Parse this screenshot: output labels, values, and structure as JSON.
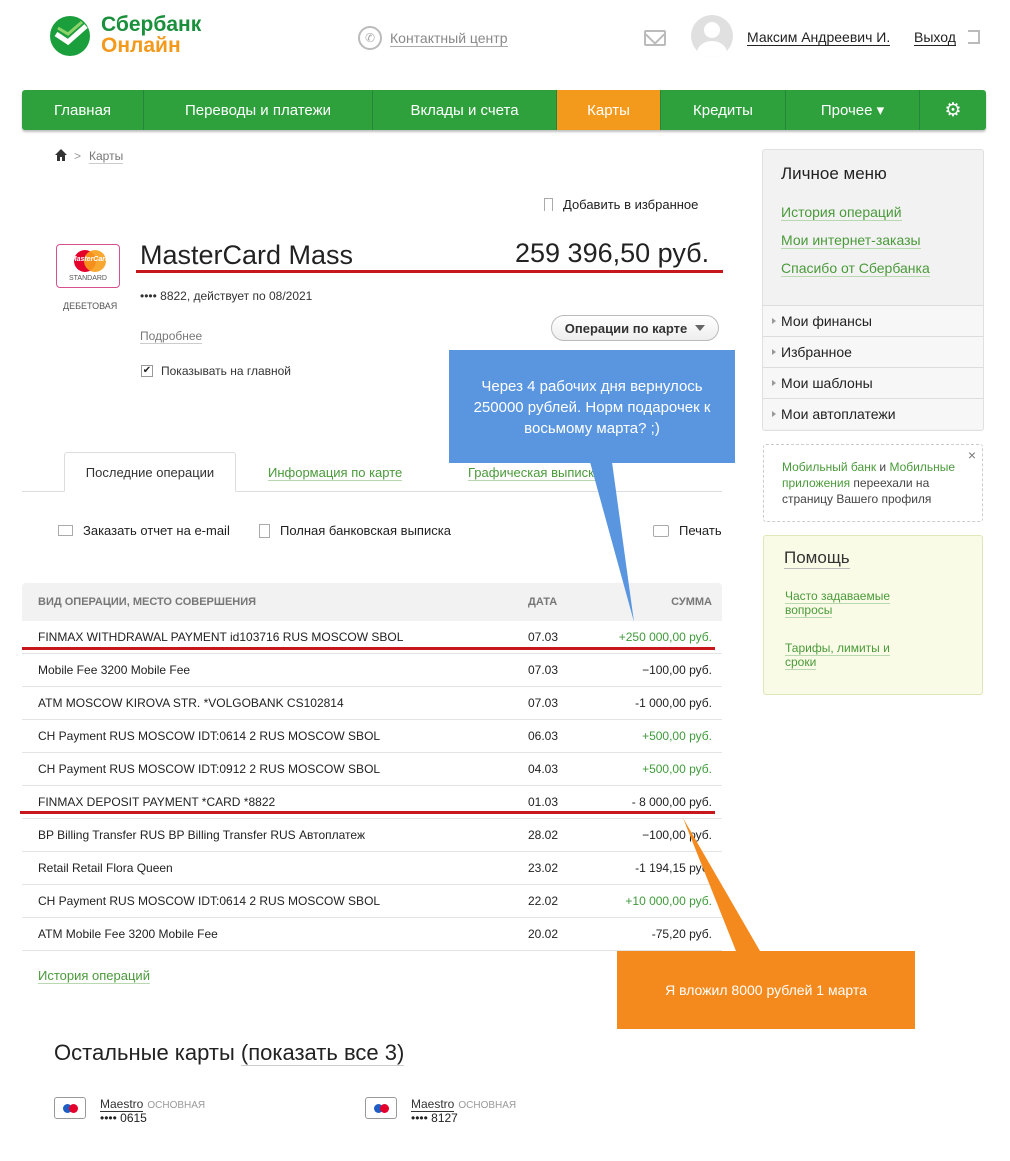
{
  "header": {
    "logo_line1": "Сбербанк",
    "logo_line2": "Онлайн",
    "contact_center": "Контактный центр",
    "user_name": "Максим Андреевич И.",
    "logout": "Выход"
  },
  "nav": {
    "items": [
      {
        "label": "Главная"
      },
      {
        "label": "Переводы и платежи"
      },
      {
        "label": "Вклады и счета"
      },
      {
        "label": "Карты"
      },
      {
        "label": "Кредиты"
      },
      {
        "label": "Прочее ▾"
      }
    ],
    "active": "Карты",
    "colors": {
      "nav": "#2ea13d",
      "active": "#f39a1d"
    }
  },
  "breadcrumb": {
    "cards": "Карты"
  },
  "favorite": "Добавить в избранное",
  "card": {
    "name": "MasterCard Mass",
    "balance": "259 396,50 руб.",
    "logo_text": "MasterCard",
    "logo_sub": "STANDARD",
    "kind": "ДЕБЕТОВАЯ",
    "number_info": "•••• 8822, действует по 08/2021",
    "details": "Подробнее",
    "operations_button": "Операции по карте",
    "show_on_main": "Показывать на главной",
    "show_on_main_checked": "✔"
  },
  "tabs": {
    "recent": "Последние операции",
    "info": "Информация по карте",
    "graph": "Графическая выписка"
  },
  "actions": {
    "email_report": "Заказать отчет на e-mail",
    "full_statement": "Полная банковская выписка",
    "print": "Печать"
  },
  "table": {
    "headers": {
      "desc": "ВИД ОПЕРАЦИИ, МЕСТО СОВЕРШЕНИЯ",
      "date": "ДАТА",
      "sum": "СУММА"
    },
    "rows": [
      {
        "desc": "FINMAX WITHDRAWAL PAYMENT id103716 RUS MOSCOW SBOL",
        "date": "07.03",
        "sum": "+250 000,00 руб."
      },
      {
        "desc": "Mobile Fee 3200 Mobile Fee",
        "date": "07.03",
        "sum": "−100,00 руб."
      },
      {
        "desc": "ATM MOSCOW KIROVA STR. *VOLGOBANK CS102814",
        "date": "07.03",
        "sum": "-1 000,00 руб."
      },
      {
        "desc": "CH Payment RUS MOSCOW IDT:0614 2 RUS MOSCOW SBOL",
        "date": "06.03",
        "sum": "+500,00 руб."
      },
      {
        "desc": "CH Payment RUS MOSCOW IDT:0912 2 RUS MOSCOW SBOL",
        "date": "04.03",
        "sum": "+500,00 руб."
      },
      {
        "desc": "FINMAX DEPOSIT PAYMENT *CARD *8822",
        "date": "01.03",
        "sum": "- 8 000,00 руб."
      },
      {
        "desc": "BP Billing Transfer RUS BP Billing Transfer RUS Автоплатеж",
        "date": "28.02",
        "sum": "−100,00 руб."
      },
      {
        "desc": "Retail Retail Flora Queen",
        "date": "23.02",
        "sum": "-1 194,15 руб."
      },
      {
        "desc": "CH Payment RUS MOSCOW IDT:0614 2 RUS MOSCOW SBOL",
        "date": "22.02",
        "sum": "+10 000,00 руб."
      },
      {
        "desc": "ATM Mobile Fee 3200 Mobile Fee",
        "date": "20.02",
        "sum": "-75,20 руб."
      }
    ],
    "history_link": "История операций"
  },
  "other_cards": {
    "title_prefix": "Остальные карты ",
    "title_link": "(показать все 3)",
    "cards": [
      {
        "name": "Maestro",
        "tag": "ОСНОВНАЯ",
        "number": "•••• 0615"
      },
      {
        "name": "Maestro",
        "tag": "ОСНОВНАЯ",
        "number": "•••• 8127"
      }
    ]
  },
  "personal_menu": {
    "title": "Личное меню",
    "links": [
      "История операций",
      "Мои интернет-заказы",
      "Спасибо от Сбербанка"
    ],
    "sections": [
      "Мои финансы",
      "Избранное",
      "Мои шаблоны",
      "Мои автоплатежи"
    ]
  },
  "notice": {
    "link1": "Мобильный банк",
    "and": " и ",
    "link2": "Мобильные приложения",
    "text": " переехали на страницу Вашего профиля",
    "close": "×"
  },
  "help": {
    "title": "Помощь",
    "faq": "Часто задаваемые вопросы",
    "tariffs": "Тарифы, лимиты и сроки"
  },
  "annotations": {
    "blue": "Через 4 рабочих дня вернулось 250000 рублей. Норм подарочек к восьмому марта? ;)",
    "orange": "Я вложил 8000 рублей 1 марта",
    "colors": {
      "blue": "#5a96e0",
      "orange": "#f48a1e",
      "underline": "#c8161d"
    }
  }
}
